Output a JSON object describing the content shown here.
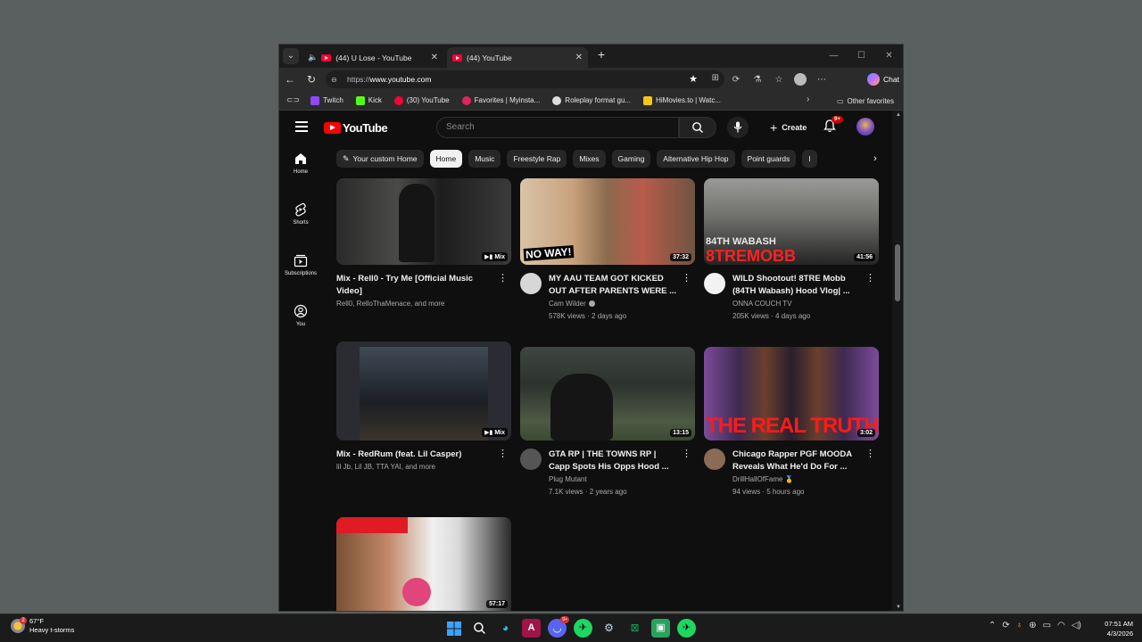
{
  "browser": {
    "tabs": [
      {
        "title": "(44) U Lose - YouTube",
        "active": false,
        "audio": true
      },
      {
        "title": "(44) YouTube",
        "active": true,
        "audio": false
      }
    ],
    "url_prefix": "https://",
    "url_host": "www.youtube.com",
    "chat_label": "Chat",
    "bookmarks": [
      {
        "label": "Twitch",
        "color": "#9146ff"
      },
      {
        "label": "Kick",
        "color": "#53fc18"
      },
      {
        "label": "(30) YouTube",
        "color": "#ff0033"
      },
      {
        "label": "Favorites | Myinsta...",
        "color": "#e0245e"
      },
      {
        "label": "Roleplay format gu...",
        "color": "#dddddd"
      },
      {
        "label": "HiMovies.to | Watc...",
        "color": "#f5c518"
      }
    ],
    "other_favorites": "Other favorites"
  },
  "youtube": {
    "logo_text": "YouTube",
    "search_placeholder": "Search",
    "create_label": "Create",
    "notifications_badge": "9+",
    "sidebar": [
      {
        "label": "Home",
        "icon": "home-icon"
      },
      {
        "label": "Shorts",
        "icon": "shorts-icon"
      },
      {
        "label": "Subscriptions",
        "icon": "subscriptions-icon"
      },
      {
        "label": "You",
        "icon": "you-icon"
      }
    ],
    "chips": [
      {
        "label": "Your custom Home",
        "active": false
      },
      {
        "label": "Home",
        "active": true
      },
      {
        "label": "Music",
        "active": false
      },
      {
        "label": "Freestyle Rap",
        "active": false
      },
      {
        "label": "Mixes",
        "active": false
      },
      {
        "label": "Gaming",
        "active": false
      },
      {
        "label": "Alternative Hip Hop",
        "active": false
      },
      {
        "label": "Point guards",
        "active": false
      }
    ],
    "videos": [
      {
        "title": "Mix - Rell0 - Try Me [Official Music Video]",
        "line1": "Rell0, RelloThaMenace, and more",
        "line2": "",
        "duration": "Mix",
        "has_avatar": false
      },
      {
        "title": "MY AAU TEAM GOT KICKED OUT AFTER PARENTS WERE ...",
        "line1": "Cam Wilder",
        "line2": "578K views · 2 days ago",
        "duration": "37:32",
        "has_avatar": true,
        "verified": true,
        "thumb_text": "NO WAY!"
      },
      {
        "title": "WILD Shootout! 8TRE Mobb (84TH Wabash) Hood Vlog| ...",
        "line1": "ONNA COUCH TV",
        "line2": "205K views · 4 days ago",
        "duration": "41:56",
        "has_avatar": true,
        "thumb_text": "84TH WABASH",
        "thumb_text_big": "8TREMOBB"
      },
      {
        "title": "Mix - RedRum (feat. Lil Casper)",
        "line1": "lil Jb, Lil JB, TTA YAI, and more",
        "line2": "",
        "duration": "Mix",
        "has_avatar": false
      },
      {
        "title": "GTA RP | THE TOWNS RP | Capp Spots His Opps Hood ...",
        "line1": "Plug Mutant",
        "line2": "7.1K views · 2 years ago",
        "duration": "13:15",
        "has_avatar": true
      },
      {
        "title": "Chicago Rapper PGF MOODA Reveals What He'd Do For ...",
        "line1": "DrillHallOfFame 🏅",
        "line2": "94 views · 5 hours ago",
        "duration": "3:02",
        "has_avatar": true,
        "thumb_text": "THE REAL TRUTH"
      },
      {
        "title": "",
        "line1": "",
        "line2": "",
        "duration": "57:17",
        "has_avatar": false
      }
    ]
  },
  "taskbar": {
    "weather_temp": "67°F",
    "weather_desc": "Heavy t-storms",
    "weather_badge": "2",
    "discord_badge": "9+",
    "time": "07:51 AM",
    "date": "4/3/2026"
  }
}
